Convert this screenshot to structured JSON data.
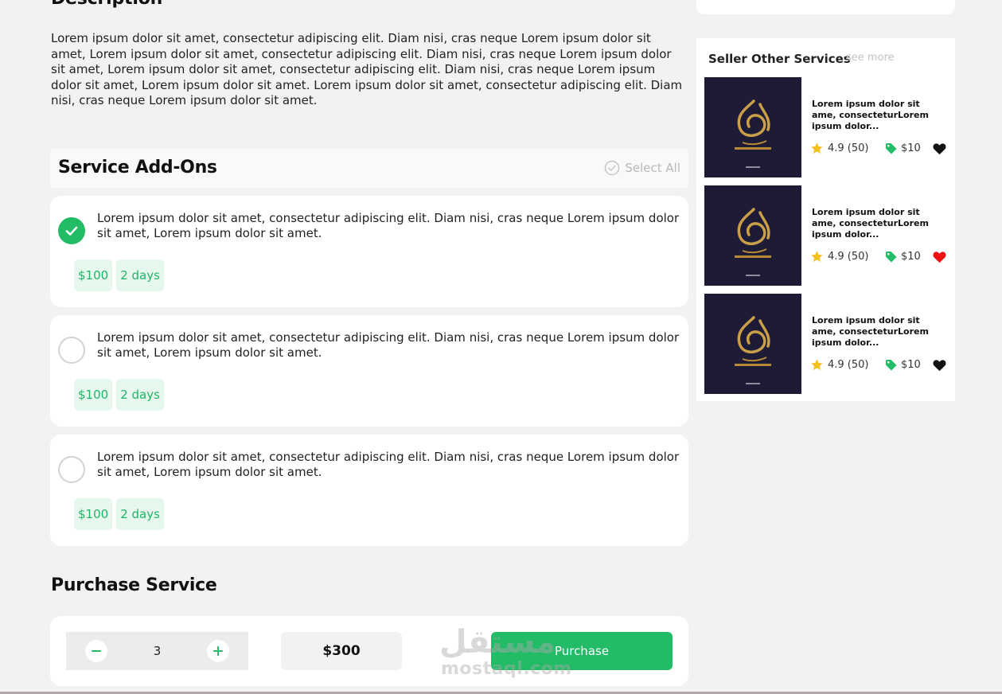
{
  "description": {
    "title": "Description",
    "text": "Lorem ipsum dolor sit amet, consectetur adipiscing elit. Diam nisi, cras neque Lorem ipsum dolor sit amet, Lorem ipsum dolor sit amet, consectetur adipiscing elit. Diam nisi, cras neque Lorem ipsum dolor sit amet, Lorem ipsum dolor sit amet, consectetur adipiscing elit. Diam nisi, cras neque Lorem ipsum dolor sit amet, Lorem ipsum dolor sit amet. Lorem ipsum dolor sit amet, consectetur adipiscing elit. Diam nisi, cras neque Lorem ipsum dolor sit amet."
  },
  "addons": {
    "title": "Service Add-Ons",
    "select_all": "Select All",
    "items": [
      {
        "text": "Lorem ipsum dolor sit amet, consectetur adipiscing elit. Diam nisi, cras neque Lorem ipsum dolor sit amet, Lorem ipsum dolor sit amet.",
        "price": "$100",
        "duration": "2 days",
        "checked": true
      },
      {
        "text": "Lorem ipsum dolor sit amet, consectetur adipiscing elit. Diam nisi, cras neque Lorem ipsum dolor sit amet, Lorem ipsum dolor sit amet.",
        "price": "$100",
        "duration": "2 days",
        "checked": false
      },
      {
        "text": "Lorem ipsum dolor sit amet, consectetur adipiscing elit. Diam nisi, cras neque Lorem ipsum dolor sit amet, Lorem ipsum dolor sit amet.",
        "price": "$100",
        "duration": "2 days",
        "checked": false
      }
    ]
  },
  "purchase": {
    "title": "Purchase Service",
    "quantity": "3",
    "total": "$300",
    "button_label": "Purchase"
  },
  "watermark": {
    "arabic": "مستقل",
    "latin": "mostaql.com"
  },
  "sidebar": {
    "title": "Seller Other Services",
    "see_more": "see more",
    "services": [
      {
        "title": "Lorem ipsum dolor sit ame, consecteturLorem ipsum dolor...",
        "rating": "4.9 (50)",
        "price": "$10",
        "favorited": false
      },
      {
        "title": "Lorem ipsum dolor sit ame, consecteturLorem ipsum dolor...",
        "rating": "4.9 (50)",
        "price": "$10",
        "favorited": true
      },
      {
        "title": "Lorem ipsum dolor sit ame, consecteturLorem ipsum dolor...",
        "rating": "4.9 (50)",
        "price": "$10",
        "favorited": false
      }
    ]
  },
  "colors": {
    "accent": "#22bb66",
    "tag_bg": "#e6f7ee",
    "heart_active": "#ee1111",
    "star": "#f5c120",
    "thumb_bg": "#1e1b36"
  },
  "icons": {
    "select_all": "check-circle-icon",
    "addon_check": "check-icon",
    "minus": "minus-icon",
    "plus": "plus-icon",
    "star": "star-icon",
    "price_tag": "price-tag-icon",
    "favorite": "heart-icon"
  }
}
